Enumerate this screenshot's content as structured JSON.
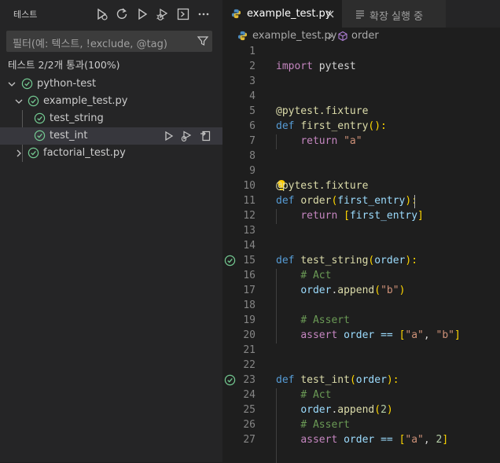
{
  "sidebar": {
    "title": "테스트",
    "filter_placeholder": "필터(예: 텍스트, !exclude, @tag)",
    "summary": "테스트 2/2개 통과(100%)",
    "tree": [
      {
        "label": "python-test"
      },
      {
        "label": "example_test.py"
      },
      {
        "label": "test_string"
      },
      {
        "label": "test_int"
      },
      {
        "label": "factorial_test.py"
      }
    ]
  },
  "tabs": [
    {
      "label": "example_test.py",
      "active": true
    },
    {
      "label": "확장 실행 중",
      "active": false
    }
  ],
  "breadcrumb": {
    "file": "example_test.py",
    "symbol": "order"
  },
  "code": {
    "line_numbers": [
      "1",
      "2",
      "3",
      "4",
      "5",
      "6",
      "7",
      "8",
      "9",
      "10",
      "11",
      "12",
      "13",
      "14",
      "15",
      "16",
      "17",
      "18",
      "19",
      "20",
      "21",
      "22",
      "23",
      "24",
      "25",
      "26",
      "27"
    ],
    "line2": {
      "kw": "import",
      "mod": " pytest"
    },
    "line5": "@pytest.fixture",
    "line6": {
      "kw": "def",
      "fn": "first_entry",
      "rest": "():"
    },
    "line7": {
      "kw": "return",
      "str": "\"a\""
    },
    "line10": "@pytest.fixture",
    "line11": {
      "kw": "def",
      "fn": "order",
      "param": "first_entry",
      "rest": "):"
    },
    "line12": {
      "kw": "return",
      "param": "first_entry"
    },
    "line15": {
      "kw": "def",
      "fn": "test_string",
      "param": "order",
      "rest": "):"
    },
    "line16": "# Act",
    "line17": {
      "obj": "order",
      "fn": "append",
      "str": "\"b\""
    },
    "line19": "# Assert",
    "line20": {
      "kw": "assert",
      "obj": " order == ",
      "s1": "\"a\"",
      "s2": "\"b\""
    },
    "line23": {
      "kw": "def",
      "fn": "test_int",
      "param": "order",
      "rest": "):"
    },
    "line24": "# Act",
    "line25": {
      "obj": "order",
      "fn": "append",
      "num": "2"
    },
    "line26": "# Assert",
    "line27": {
      "kw": "assert",
      "obj": " order == ",
      "s1": "\"a\"",
      "num": "2"
    }
  },
  "colors": {
    "pass": "#73c991",
    "accent": "#569cd6",
    "selection": "#37373d"
  }
}
